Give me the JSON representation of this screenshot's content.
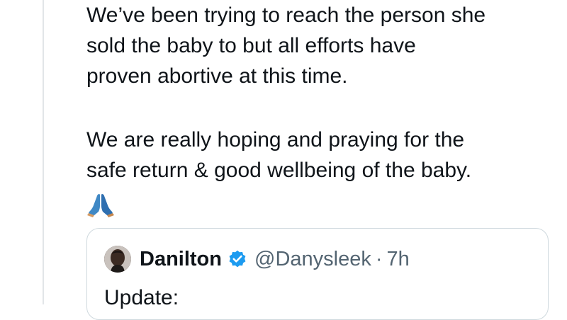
{
  "tweet": {
    "paragraph_1_lines": [
      "We’ve been trying to reach the person she",
      "sold the baby to but all efforts have",
      "proven abortive at this time."
    ],
    "paragraph_2_lines": [
      "We are really hoping and praying for the",
      "safe return & good wellbeing of the baby."
    ],
    "emoji": "folded-hands-emoji"
  },
  "quoted_tweet": {
    "display_name": "Danilton",
    "verified_icon": "verified-badge-icon",
    "handle": "@Danysleek",
    "separator": "·",
    "time": "7h",
    "text": "Update:"
  },
  "colors": {
    "text_primary": "#0f1419",
    "text_secondary": "#536471",
    "verified_blue": "#1d9bf0",
    "border": "#cfd9de",
    "thread_line": "#e2e5e8"
  }
}
